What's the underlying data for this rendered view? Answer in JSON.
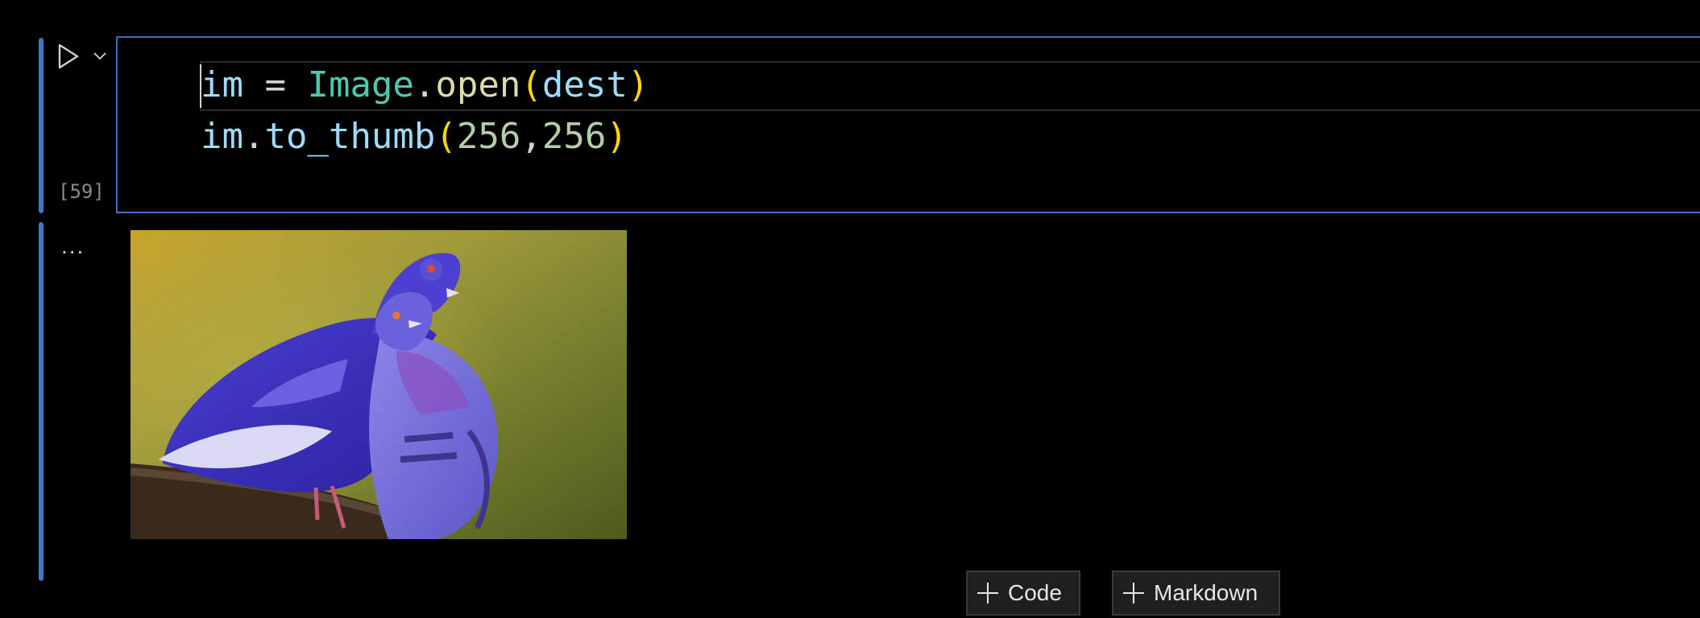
{
  "cell": {
    "execution_count": "[59]",
    "code": {
      "line1": {
        "var": "im",
        "op": " = ",
        "cls": "Image",
        "dot": ".",
        "fn": "open",
        "lparen": "(",
        "arg": "dest",
        "rparen": ")"
      },
      "line2": {
        "var": "im",
        "dot": ".",
        "fn": "to_thumb",
        "lparen": "(",
        "num1": "256",
        "comma": ",",
        "num2": "256",
        "rparen": ")"
      }
    },
    "output_toggle": "...",
    "output_image": "two-pigeons-photo"
  },
  "toolbar": {
    "add_code_label": "Code",
    "add_markdown_label": "Markdown"
  },
  "icons": {
    "run": "play-icon",
    "run_menu": "chevron-down-icon",
    "add": "plus-icon"
  },
  "colors": {
    "focus_bar": "#3b78c9",
    "editor_border": "#3b6fc2",
    "background": "#000000",
    "button_bg": "#1f1f1f"
  }
}
